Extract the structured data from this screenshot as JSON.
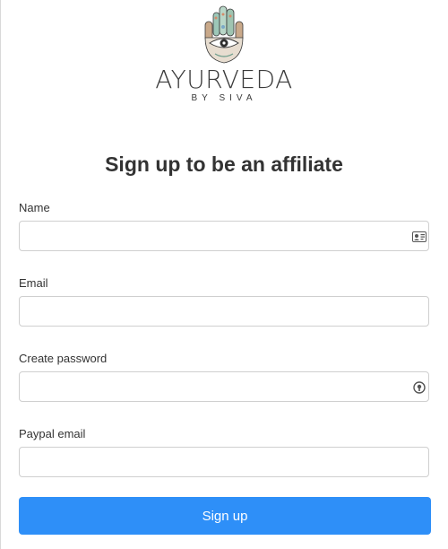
{
  "brand": {
    "name": "AYURVEDA",
    "tagline": "BY SIVA"
  },
  "title": "Sign up to be an affiliate",
  "fields": {
    "name": {
      "label": "Name",
      "value": "",
      "placeholder": "",
      "icon": "contact-card-icon"
    },
    "email": {
      "label": "Email",
      "value": "",
      "placeholder": ""
    },
    "password": {
      "label": "Create password",
      "value": "",
      "placeholder": "",
      "icon": "password-manager-icon"
    },
    "paypal": {
      "label": "Paypal email",
      "value": "",
      "placeholder": ""
    }
  },
  "submit_label": "Sign up",
  "colors": {
    "accent": "#2e8ff8",
    "text": "#333333",
    "border": "#cfcfcf"
  }
}
